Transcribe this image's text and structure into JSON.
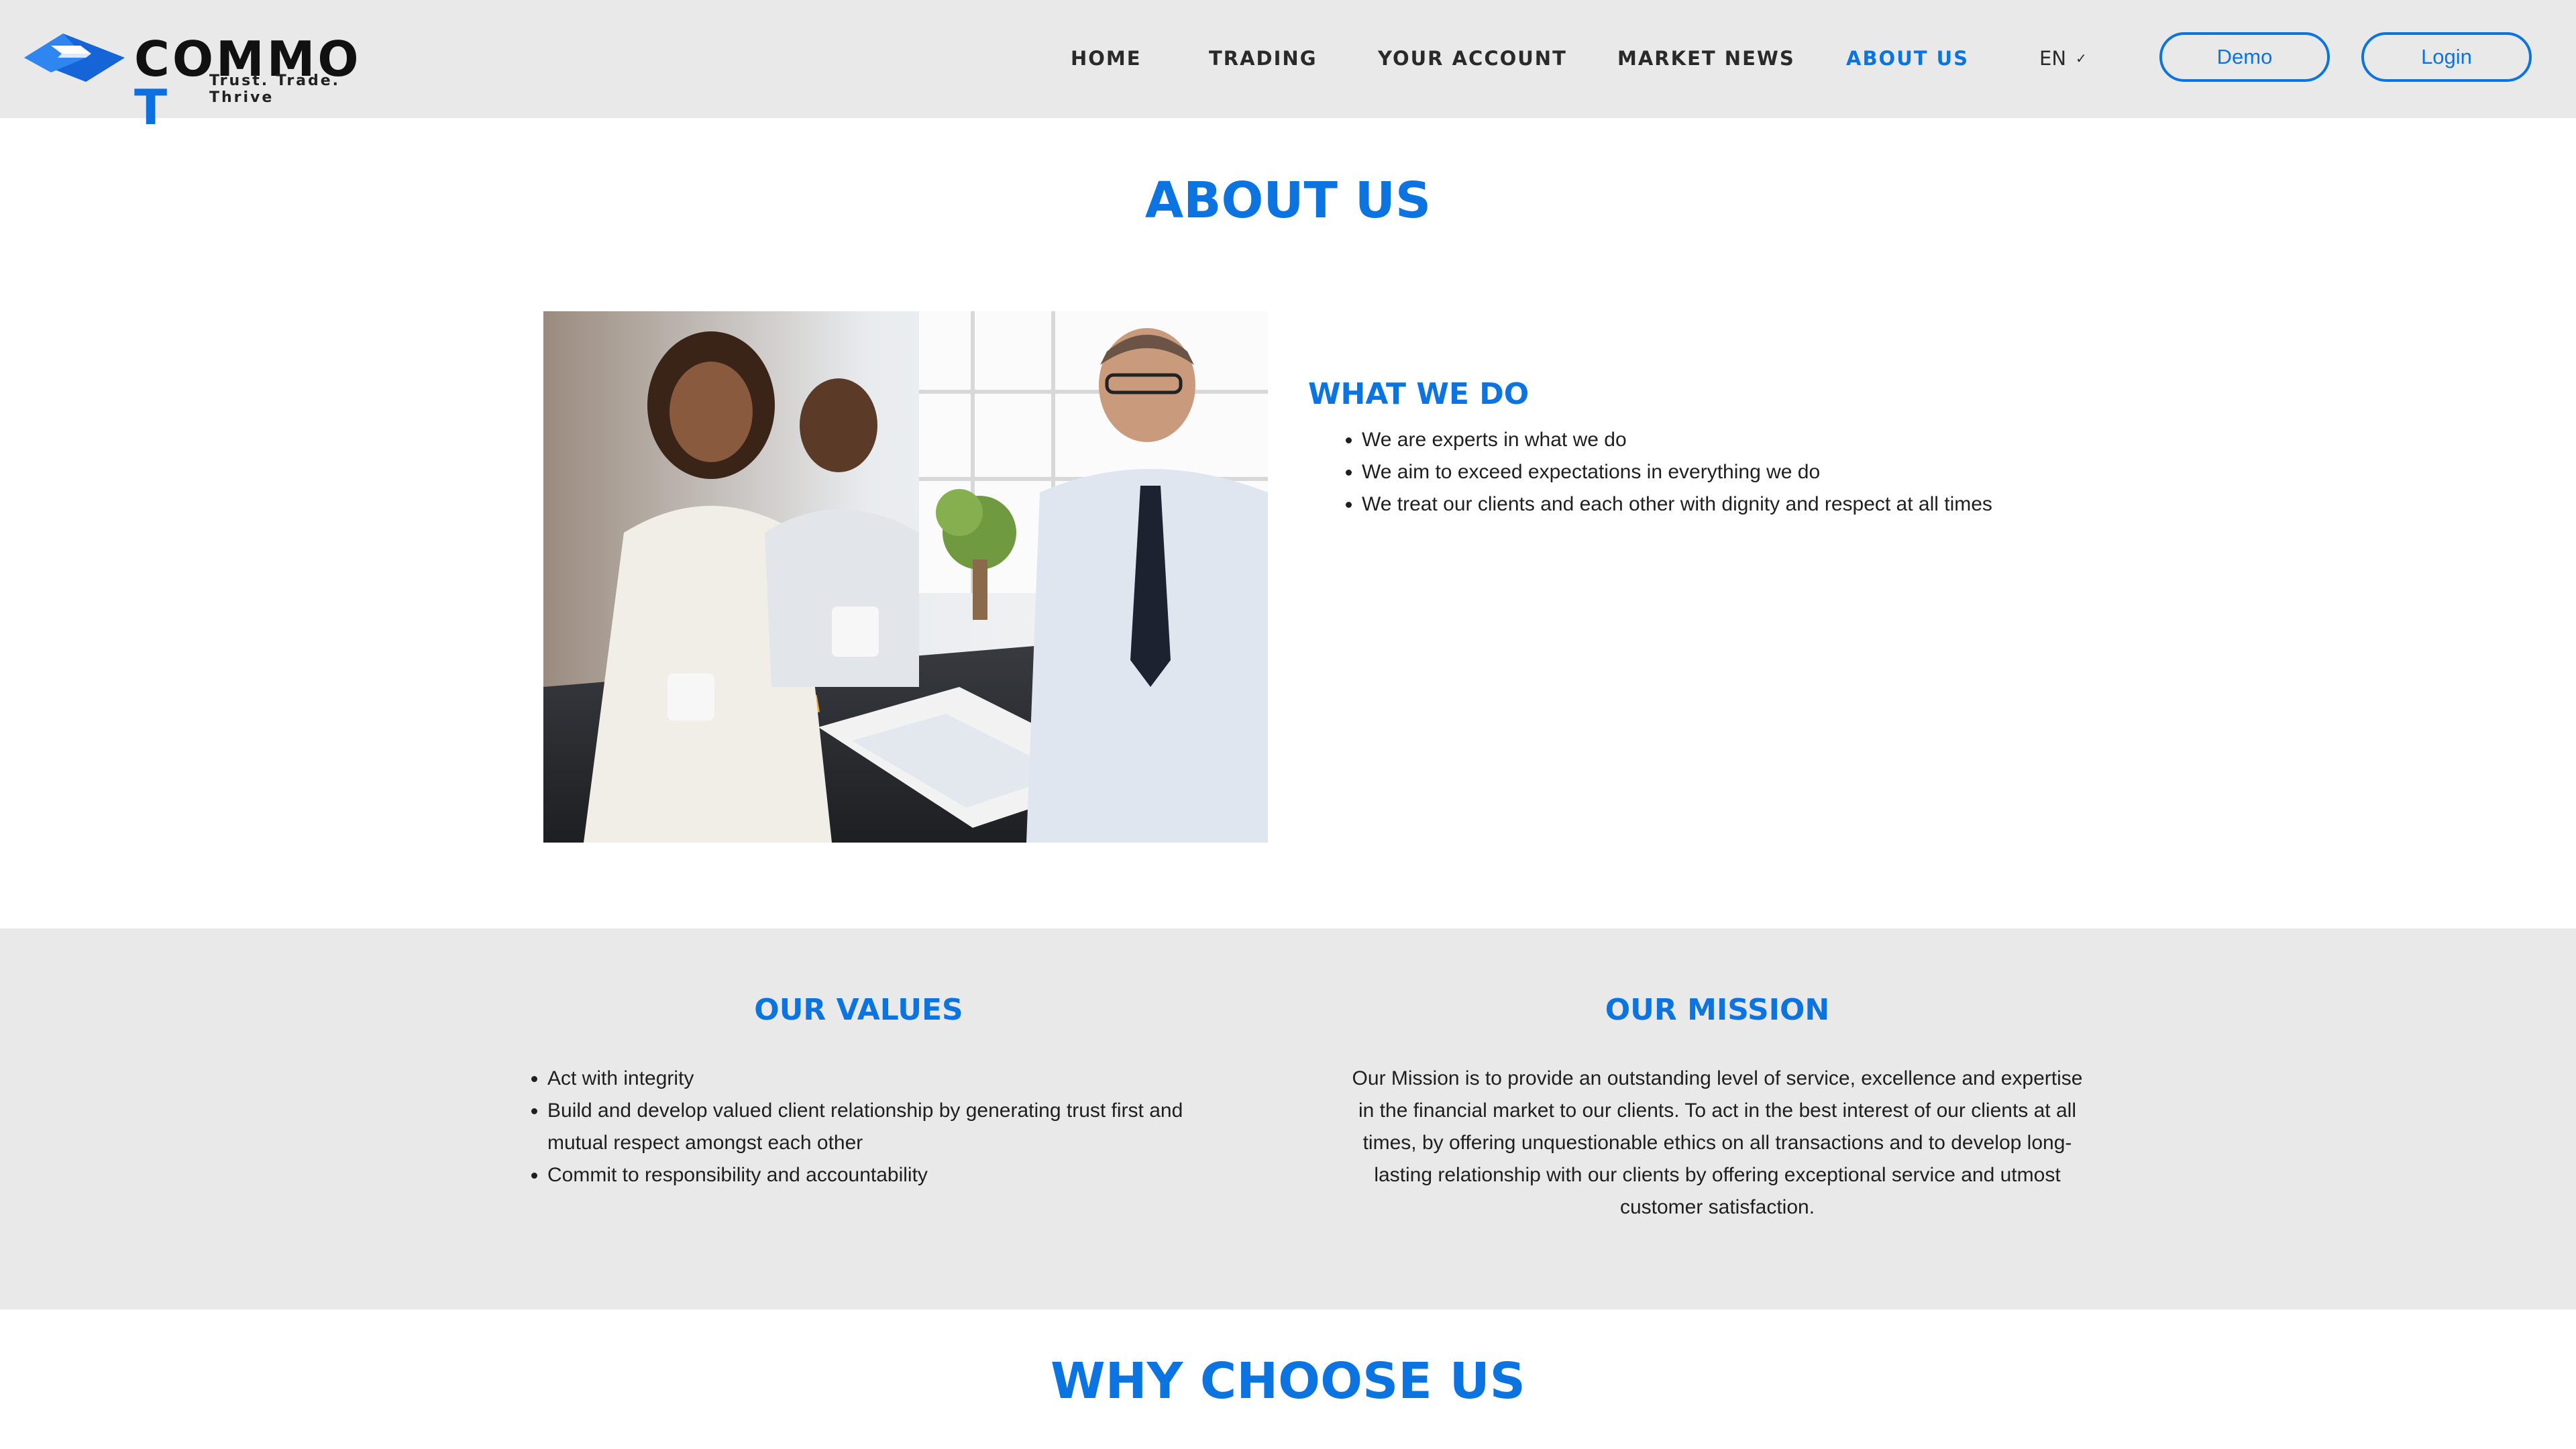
{
  "brand": {
    "name_main": "COMMO",
    "name_accent": "T",
    "tagline": "Trust. Trade. Thrive",
    "accent_color": "#0b74e0"
  },
  "nav": {
    "items": [
      {
        "label": "HOME",
        "active": false
      },
      {
        "label": "TRADING",
        "active": false
      },
      {
        "label": "YOUR ACCOUNT",
        "active": false
      },
      {
        "label": "MARKET NEWS",
        "active": false
      },
      {
        "label": "ABOUT US",
        "active": true
      }
    ],
    "language": "EN",
    "demo_label": "Demo",
    "login_label": "Login"
  },
  "about": {
    "title": "ABOUT US",
    "photo_icon": "team-meeting-photo",
    "what_we_do": {
      "heading": "WHAT WE DO",
      "items": [
        "We are experts in what we do",
        "We aim to exceed expectations in everything we do",
        "We treat our clients and each other with dignity and respect at all times"
      ]
    }
  },
  "values": {
    "heading": "OUR VALUES",
    "items": [
      "Act with integrity",
      "Build and develop valued client relationship by generating trust first and mutual respect amongst each other",
      "Commit to responsibility and accountability"
    ]
  },
  "mission": {
    "heading": "OUR MISSION",
    "text": "Our Mission is to provide an outstanding level of service, excellence and expertise in the financial market to our clients. To act in the best interest of our clients at all times, by offering unquestionable ethics on all transactions and to develop long-lasting relationship with our clients by offering exceptional service and utmost customer satisfaction."
  },
  "why": {
    "title": "WHY CHOOSE US"
  }
}
